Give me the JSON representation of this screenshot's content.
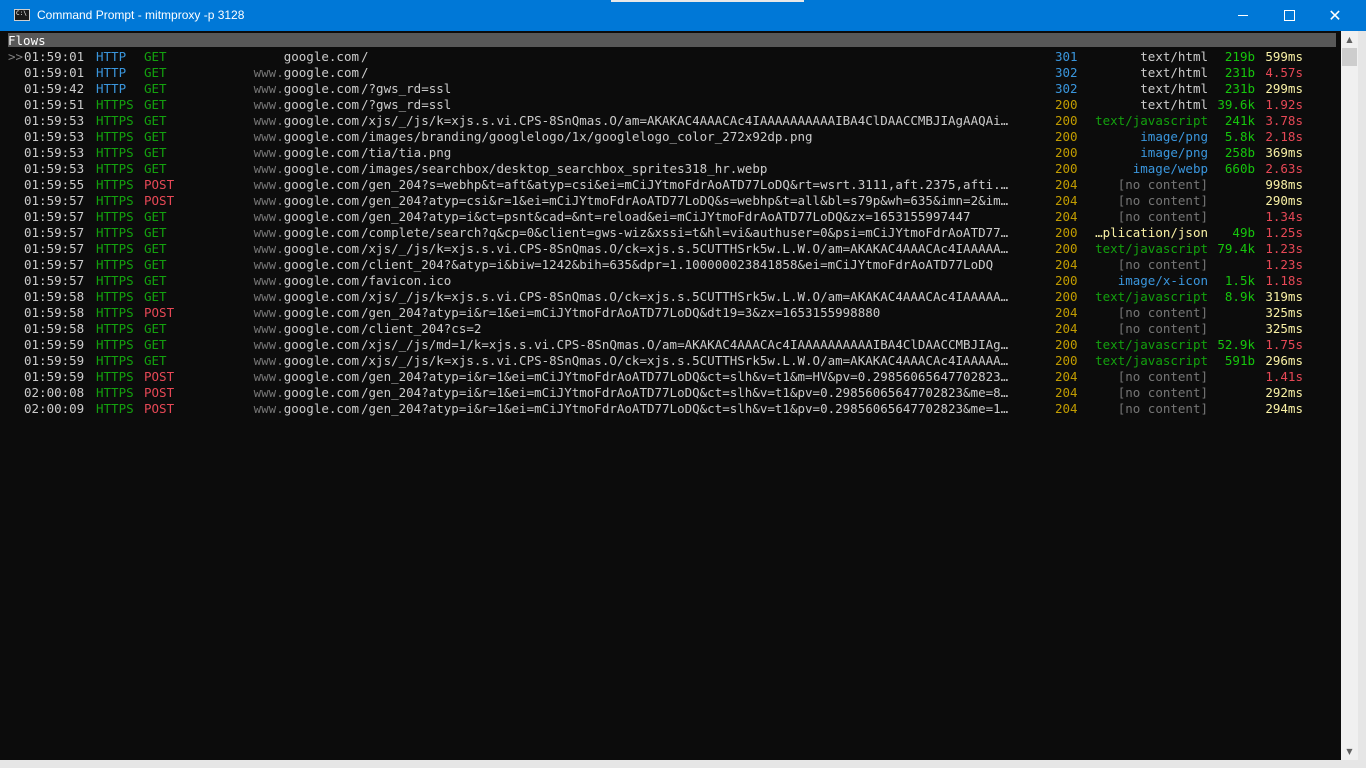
{
  "window": {
    "title": "Command Prompt - mitmproxy  -p 3128",
    "icon": "cmd-app-icon",
    "buttons": {
      "minimize": "minimize-icon",
      "maximize": "maximize-icon",
      "close": "✕"
    }
  },
  "header": {
    "label": "Flows"
  },
  "cursor": ">>",
  "flows": [
    {
      "time": "01:59:01",
      "scheme": "HTTP",
      "method": "GET",
      "host_sub": "",
      "host_dom": "google.com",
      "path": "/",
      "code": "301",
      "ctype": "text/html",
      "size": "219b",
      "duration": "599ms"
    },
    {
      "time": "01:59:01",
      "scheme": "HTTP",
      "method": "GET",
      "host_sub": "www.",
      "host_dom": "google.com",
      "path": "/",
      "code": "302",
      "ctype": "text/html",
      "size": "231b",
      "duration": "4.57s"
    },
    {
      "time": "01:59:42",
      "scheme": "HTTP",
      "method": "GET",
      "host_sub": "www.",
      "host_dom": "google.com",
      "path": "/?gws_rd=ssl",
      "code": "302",
      "ctype": "text/html",
      "size": "231b",
      "duration": "299ms"
    },
    {
      "time": "01:59:51",
      "scheme": "HTTPS",
      "method": "GET",
      "host_sub": "www.",
      "host_dom": "google.com",
      "path": "/?gws_rd=ssl",
      "code": "200",
      "ctype": "text/html",
      "size": "39.6k",
      "duration": "1.92s"
    },
    {
      "time": "01:59:53",
      "scheme": "HTTPS",
      "method": "GET",
      "host_sub": "www.",
      "host_dom": "google.com",
      "path": "/xjs/_/js/k=xjs.s.vi.CPS-8SnQmas.O/am=AKAKAC4AAACAc4IAAAAAAAAAAIBA4ClDAACCMBJIAgAAQAi…",
      "code": "200",
      "ctype": "text/javascript",
      "size": "241k",
      "duration": "3.78s"
    },
    {
      "time": "01:59:53",
      "scheme": "HTTPS",
      "method": "GET",
      "host_sub": "www.",
      "host_dom": "google.com",
      "path": "/images/branding/googlelogo/1x/googlelogo_color_272x92dp.png",
      "code": "200",
      "ctype": "image/png",
      "size": "5.8k",
      "duration": "2.18s"
    },
    {
      "time": "01:59:53",
      "scheme": "HTTPS",
      "method": "GET",
      "host_sub": "www.",
      "host_dom": "google.com",
      "path": "/tia/tia.png",
      "code": "200",
      "ctype": "image/png",
      "size": "258b",
      "duration": "369ms"
    },
    {
      "time": "01:59:53",
      "scheme": "HTTPS",
      "method": "GET",
      "host_sub": "www.",
      "host_dom": "google.com",
      "path": "/images/searchbox/desktop_searchbox_sprites318_hr.webp",
      "code": "200",
      "ctype": "image/webp",
      "size": "660b",
      "duration": "2.63s"
    },
    {
      "time": "01:59:55",
      "scheme": "HTTPS",
      "method": "POST",
      "host_sub": "www.",
      "host_dom": "google.com",
      "path": "/gen_204?s=webhp&t=aft&atyp=csi&ei=mCiJYtmoFdrAoATD77LoDQ&rt=wsrt.3111,aft.2375,afti.…",
      "code": "204",
      "ctype": "[no content]",
      "size": "",
      "duration": "998ms"
    },
    {
      "time": "01:59:57",
      "scheme": "HTTPS",
      "method": "POST",
      "host_sub": "www.",
      "host_dom": "google.com",
      "path": "/gen_204?atyp=csi&r=1&ei=mCiJYtmoFdrAoATD77LoDQ&s=webhp&t=all&bl=s79p&wh=635&imn=2&im…",
      "code": "204",
      "ctype": "[no content]",
      "size": "",
      "duration": "290ms"
    },
    {
      "time": "01:59:57",
      "scheme": "HTTPS",
      "method": "GET",
      "host_sub": "www.",
      "host_dom": "google.com",
      "path": "/gen_204?atyp=i&ct=psnt&cad=&nt=reload&ei=mCiJYtmoFdrAoATD77LoDQ&zx=1653155997447",
      "code": "204",
      "ctype": "[no content]",
      "size": "",
      "duration": "1.34s"
    },
    {
      "time": "01:59:57",
      "scheme": "HTTPS",
      "method": "GET",
      "host_sub": "www.",
      "host_dom": "google.com",
      "path": "/complete/search?q&cp=0&client=gws-wiz&xssi=t&hl=vi&authuser=0&psi=mCiJYtmoFdrAoATD77…",
      "code": "200",
      "ctype": "…plication/json",
      "size": "49b",
      "duration": "1.25s"
    },
    {
      "time": "01:59:57",
      "scheme": "HTTPS",
      "method": "GET",
      "host_sub": "www.",
      "host_dom": "google.com",
      "path": "/xjs/_/js/k=xjs.s.vi.CPS-8SnQmas.O/ck=xjs.s.5CUTTHSrk5w.L.W.O/am=AKAKAC4AAACAc4IAAAAA…",
      "code": "200",
      "ctype": "text/javascript",
      "size": "79.4k",
      "duration": "1.23s"
    },
    {
      "time": "01:59:57",
      "scheme": "HTTPS",
      "method": "GET",
      "host_sub": "www.",
      "host_dom": "google.com",
      "path": "/client_204?&atyp=i&biw=1242&bih=635&dpr=1.100000023841858&ei=mCiJYtmoFdrAoATD77LoDQ",
      "code": "204",
      "ctype": "[no content]",
      "size": "",
      "duration": "1.23s"
    },
    {
      "time": "01:59:57",
      "scheme": "HTTPS",
      "method": "GET",
      "host_sub": "www.",
      "host_dom": "google.com",
      "path": "/favicon.ico",
      "code": "200",
      "ctype": "image/x-icon",
      "size": "1.5k",
      "duration": "1.18s"
    },
    {
      "time": "01:59:58",
      "scheme": "HTTPS",
      "method": "GET",
      "host_sub": "www.",
      "host_dom": "google.com",
      "path": "/xjs/_/js/k=xjs.s.vi.CPS-8SnQmas.O/ck=xjs.s.5CUTTHSrk5w.L.W.O/am=AKAKAC4AAACAc4IAAAAA…",
      "code": "200",
      "ctype": "text/javascript",
      "size": "8.9k",
      "duration": "319ms"
    },
    {
      "time": "01:59:58",
      "scheme": "HTTPS",
      "method": "POST",
      "host_sub": "www.",
      "host_dom": "google.com",
      "path": "/gen_204?atyp=i&r=1&ei=mCiJYtmoFdrAoATD77LoDQ&dt19=3&zx=1653155998880",
      "code": "204",
      "ctype": "[no content]",
      "size": "",
      "duration": "325ms"
    },
    {
      "time": "01:59:58",
      "scheme": "HTTPS",
      "method": "GET",
      "host_sub": "www.",
      "host_dom": "google.com",
      "path": "/client_204?cs=2",
      "code": "204",
      "ctype": "[no content]",
      "size": "",
      "duration": "325ms"
    },
    {
      "time": "01:59:59",
      "scheme": "HTTPS",
      "method": "GET",
      "host_sub": "www.",
      "host_dom": "google.com",
      "path": "/xjs/_/js/md=1/k=xjs.s.vi.CPS-8SnQmas.O/am=AKAKAC4AAACAc4IAAAAAAAAAAIBA4ClDAACCMBJIAg…",
      "code": "200",
      "ctype": "text/javascript",
      "size": "52.9k",
      "duration": "1.75s"
    },
    {
      "time": "01:59:59",
      "scheme": "HTTPS",
      "method": "GET",
      "host_sub": "www.",
      "host_dom": "google.com",
      "path": "/xjs/_/js/k=xjs.s.vi.CPS-8SnQmas.O/ck=xjs.s.5CUTTHSrk5w.L.W.O/am=AKAKAC4AAACAc4IAAAAA…",
      "code": "200",
      "ctype": "text/javascript",
      "size": "591b",
      "duration": "296ms"
    },
    {
      "time": "01:59:59",
      "scheme": "HTTPS",
      "method": "POST",
      "host_sub": "www.",
      "host_dom": "google.com",
      "path": "/gen_204?atyp=i&r=1&ei=mCiJYtmoFdrAoATD77LoDQ&ct=slh&v=t1&m=HV&pv=0.29856065647702823…",
      "code": "204",
      "ctype": "[no content]",
      "size": "",
      "duration": "1.41s"
    },
    {
      "time": "02:00:08",
      "scheme": "HTTPS",
      "method": "POST",
      "host_sub": "www.",
      "host_dom": "google.com",
      "path": "/gen_204?atyp=i&r=1&ei=mCiJYtmoFdrAoATD77LoDQ&ct=slh&v=t1&pv=0.29856065647702823&me=8…",
      "code": "204",
      "ctype": "[no content]",
      "size": "",
      "duration": "292ms"
    },
    {
      "time": "02:00:09",
      "scheme": "HTTPS",
      "method": "POST",
      "host_sub": "www.",
      "host_dom": "google.com",
      "path": "/gen_204?atyp=i&r=1&ei=mCiJYtmoFdrAoATD77LoDQ&ct=slh&v=t1&pv=0.29856065647702823&me=1…",
      "code": "204",
      "ctype": "[no content]",
      "size": "",
      "duration": "294ms"
    }
  ]
}
